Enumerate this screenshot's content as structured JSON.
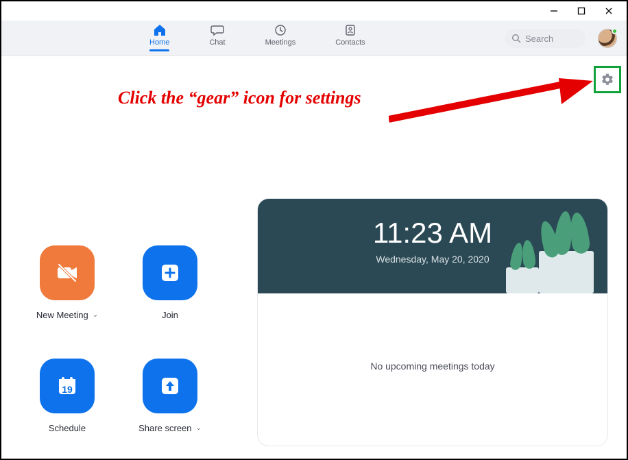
{
  "window_controls": {
    "minimize": "minimize",
    "maximize": "maximize",
    "close": "close"
  },
  "nav": {
    "tabs": [
      {
        "label": "Home",
        "active": true
      },
      {
        "label": "Chat"
      },
      {
        "label": "Meetings"
      },
      {
        "label": "Contacts"
      }
    ],
    "search_placeholder": "Search"
  },
  "annotation": "Click the “gear” icon for settings",
  "clock": {
    "time": "11:23 AM",
    "date": "Wednesday, May 20, 2020"
  },
  "meetings_empty": "No upcoming meetings today",
  "actions": {
    "new_meeting": "New Meeting",
    "join": "Join",
    "schedule": "Schedule",
    "schedule_day": "19",
    "share": "Share screen"
  }
}
